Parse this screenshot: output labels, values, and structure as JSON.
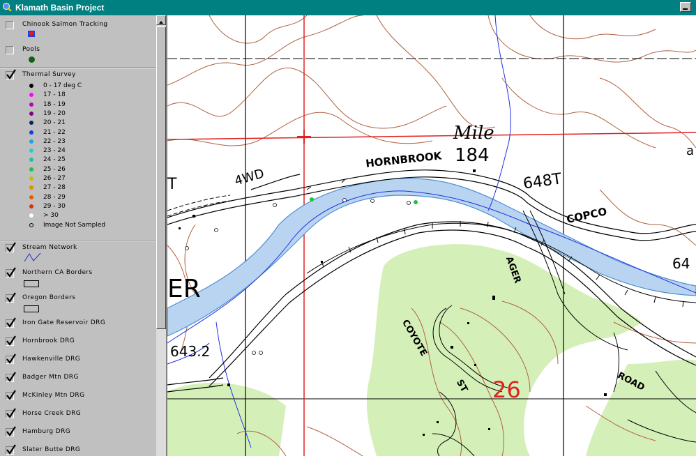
{
  "window": {
    "title": "Klamath Basin Project"
  },
  "legend": {
    "layers": [
      {
        "name": "Chinook Salmon Tracking",
        "checked": false
      },
      {
        "name": "Pools",
        "checked": false
      },
      {
        "name": "Thermal Survey",
        "checked": true
      },
      {
        "name": "Stream Network",
        "checked": true
      },
      {
        "name": "Northern CA Borders",
        "checked": true
      },
      {
        "name": "Oregon Borders",
        "checked": true
      },
      {
        "name": "Iron Gate Reservoir DRG",
        "checked": true
      },
      {
        "name": "Hornbrook DRG",
        "checked": true
      },
      {
        "name": "Hawkenville DRG",
        "checked": true
      },
      {
        "name": "Badger Mtn DRG",
        "checked": true
      },
      {
        "name": "McKinley Mtn DRG",
        "checked": true
      },
      {
        "name": "Horse Creek DRG",
        "checked": true
      },
      {
        "name": "Hamburg DRG",
        "checked": true
      },
      {
        "name": "Slater Butte DRG",
        "checked": true
      }
    ],
    "thermal_classes": [
      {
        "label": "0 - 17 deg C",
        "color": "#000000"
      },
      {
        "label": "17 - 18",
        "color": "#ff00ff"
      },
      {
        "label": "18 - 19",
        "color": "#c000c0"
      },
      {
        "label": "19 - 20",
        "color": "#800080"
      },
      {
        "label": "20 - 21",
        "color": "#102060"
      },
      {
        "label": "21 - 22",
        "color": "#1040e0"
      },
      {
        "label": "22 - 23",
        "color": "#20a0e0"
      },
      {
        "label": "23 - 24",
        "color": "#20d0d0"
      },
      {
        "label": "24 - 25",
        "color": "#20c0a0"
      },
      {
        "label": "25 - 26",
        "color": "#20c040"
      },
      {
        "label": "26 - 27",
        "color": "#c0c000"
      },
      {
        "label": "27 - 28",
        "color": "#e09000"
      },
      {
        "label": "28 - 29",
        "color": "#e06000"
      },
      {
        "label": "29 - 30",
        "color": "#e03000"
      },
      {
        "label": "> 30",
        "color": "#ffffff"
      },
      {
        "label": "Image Not Sampled",
        "color": "hollow"
      }
    ]
  },
  "map": {
    "labels": {
      "hornbrook": "HORNBROOK",
      "copco": "COPCO",
      "road": "ROAD",
      "ager": "AGER",
      "coyote": "COYOTE",
      "st": "ST",
      "fourwd": "4WD",
      "mile": "Mile",
      "mile_num": "184",
      "elev_648": "648T",
      "elev_643": "643.2",
      "elev_64": "64",
      "section": "26",
      "river_er": "ER",
      "left_t": "T",
      "a_right": "a"
    },
    "colors": {
      "river": "#b8d4f0",
      "vegetation": "#d4f0b8",
      "contour": "#b06040",
      "grid_red": "#e02020"
    }
  }
}
